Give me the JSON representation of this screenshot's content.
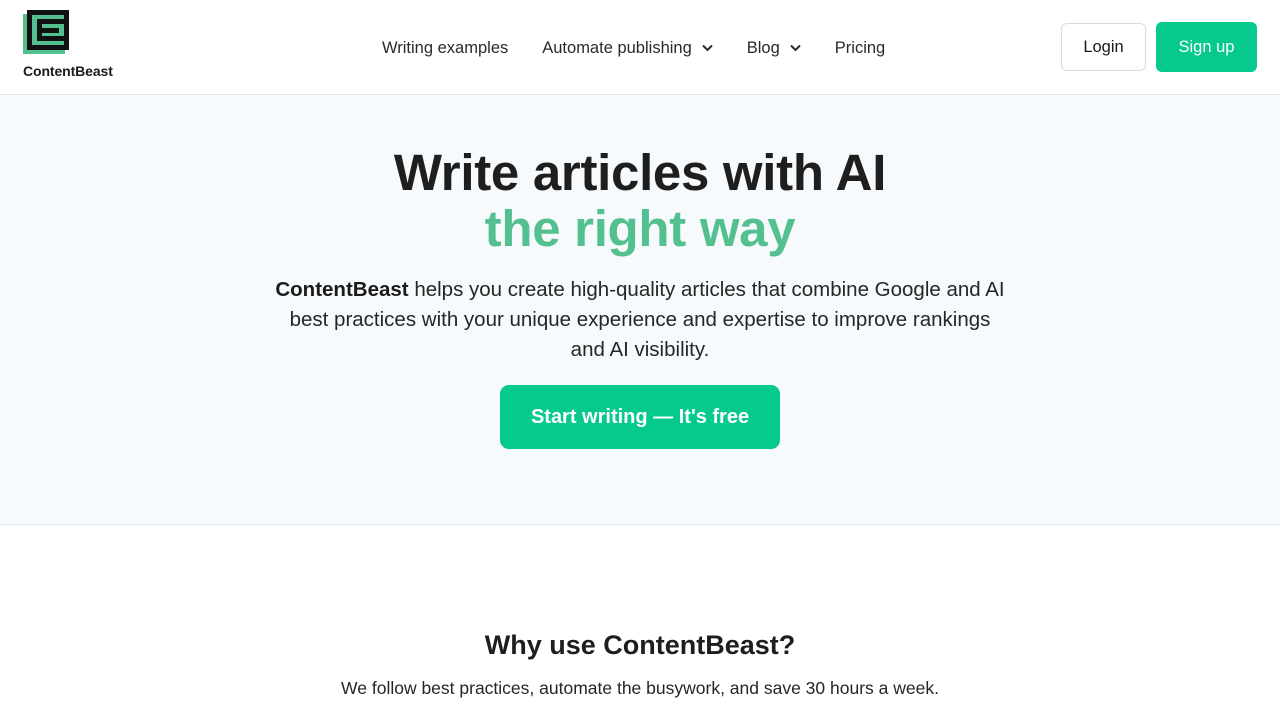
{
  "header": {
    "brand": "ContentBeast",
    "logo_icon": "contentbeast-logo-icon",
    "nav": [
      {
        "label": "Writing examples",
        "has_dropdown": false
      },
      {
        "label": "Automate publishing",
        "has_dropdown": true
      },
      {
        "label": "Blog",
        "has_dropdown": true
      },
      {
        "label": "Pricing",
        "has_dropdown": false
      }
    ],
    "login_label": "Login",
    "signup_label": "Sign up"
  },
  "hero": {
    "title": "Write articles with AI",
    "title_accent": "the right way",
    "desc_brand": "ContentBeast",
    "desc_rest": " helps you create high-quality articles that combine Google and AI best practices with your unique experience and expertise to improve rankings and AI visibility.",
    "cta_label": "Start writing — It's free"
  },
  "why": {
    "title": "Why use ContentBeast?",
    "subtitle": "We follow best practices, automate the busywork, and save 30 hours a week."
  },
  "colors": {
    "brand_green": "#05c98d",
    "accent_text_green": "#54c08f",
    "hero_bg": "#f6fafc"
  }
}
